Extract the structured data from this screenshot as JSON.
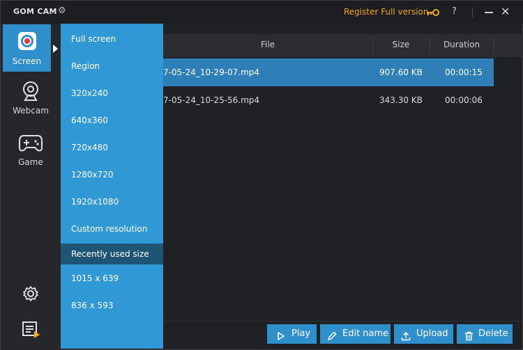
{
  "app": {
    "title": "GOM CAM",
    "register_label": "Register Full version",
    "help_label": "?",
    "close_label": "✕"
  },
  "sidebar": {
    "items": [
      {
        "label": "Screen",
        "icon": "record-icon",
        "active": true
      },
      {
        "label": "Webcam",
        "icon": "webcam-icon",
        "active": false
      },
      {
        "label": "Game",
        "icon": "gamepad-icon",
        "active": false
      }
    ]
  },
  "menu": {
    "items": [
      "Full screen",
      "Region",
      "320x240",
      "640x360",
      "720x480",
      "1280x720",
      "1920x1080",
      "Custom resolution"
    ],
    "recent_header": "Recently used size",
    "recent_items": [
      "1015 x 639",
      "836 x 593"
    ]
  },
  "table": {
    "columns": [
      "File",
      "Size",
      "Duration"
    ],
    "rows": [
      {
        "file": "7-05-24_10-29-07.mp4",
        "size": "907.60 KB",
        "duration": "00:00:15",
        "selected": true
      },
      {
        "file": "7-05-24_10-25-56.mp4",
        "size": "343.30 KB",
        "duration": "00:00:06",
        "selected": false
      }
    ]
  },
  "actions": {
    "play": "Play",
    "edit": "Edit name",
    "upload": "Upload",
    "delete": "Delete"
  },
  "colors": {
    "accent": "#2f8fcb",
    "menu": "#3098d4",
    "register": "#f4a81d",
    "background": "#1f2125"
  }
}
